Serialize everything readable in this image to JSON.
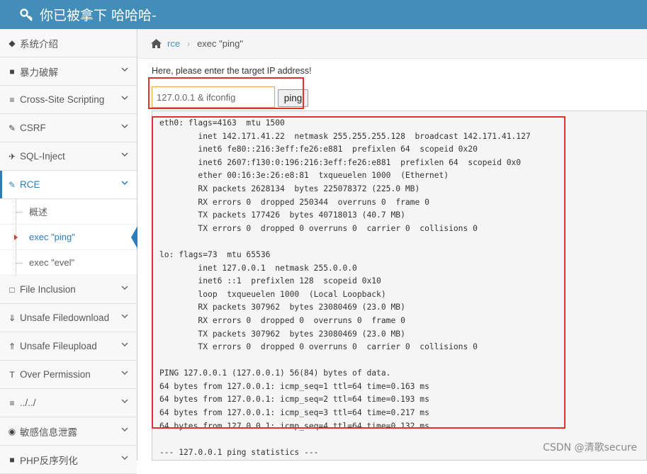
{
  "header": {
    "title": "你已被拿下 哈哈哈-",
    "logo_icon": "key-icon"
  },
  "colors": {
    "header_bg": "#438eb9",
    "accent": "#2b7dbc",
    "highlight": "#e0312f"
  },
  "sidebar": {
    "items": [
      {
        "label": "系统介绍",
        "icon": "tag-icon"
      },
      {
        "label": "暴力破解",
        "icon": "lock-icon"
      },
      {
        "label": "Cross-Site Scripting",
        "icon": "list-icon"
      },
      {
        "label": "CSRF",
        "icon": "edit-icon"
      },
      {
        "label": "SQL-Inject",
        "icon": "plane-icon"
      },
      {
        "label": "RCE",
        "icon": "pencil-icon",
        "active": true,
        "children": [
          {
            "label": "概述"
          },
          {
            "label": "exec \"ping\"",
            "active": true
          },
          {
            "label": "exec \"evel\""
          }
        ]
      },
      {
        "label": "File Inclusion",
        "icon": "file-icon"
      },
      {
        "label": "Unsafe Filedownload",
        "icon": "download-icon"
      },
      {
        "label": "Unsafe Fileupload",
        "icon": "upload-icon"
      },
      {
        "label": "Over Permission",
        "icon": "text-icon"
      },
      {
        "label": "../../",
        "icon": "align-icon"
      },
      {
        "label": "敏感信息泄露",
        "icon": "camera-icon"
      },
      {
        "label": "PHP反序列化",
        "icon": "php-icon"
      }
    ]
  },
  "breadcrumb": {
    "link": "rce",
    "current": "exec \"ping\""
  },
  "form": {
    "prompt": "Here, please enter the target IP address!",
    "ip_value": "127.0.0.1 & ifconfig",
    "button": "ping"
  },
  "output": {
    "lines": [
      "eth0: flags=4163  mtu 1500",
      "        inet 142.171.41.22  netmask 255.255.255.128  broadcast 142.171.41.127",
      "        inet6 fe80::216:3eff:fe26:e881  prefixlen 64  scopeid 0x20",
      "        inet6 2607:f130:0:196:216:3eff:fe26:e881  prefixlen 64  scopeid 0x0",
      "        ether 00:16:3e:26:e8:81  txqueuelen 1000  (Ethernet)",
      "        RX packets 2628134  bytes 225078372 (225.0 MB)",
      "        RX errors 0  dropped 250344  overruns 0  frame 0",
      "        TX packets 177426  bytes 40718013 (40.7 MB)",
      "        TX errors 0  dropped 0 overruns 0  carrier 0  collisions 0",
      "",
      "lo: flags=73  mtu 65536",
      "        inet 127.0.0.1  netmask 255.0.0.0",
      "        inet6 ::1  prefixlen 128  scopeid 0x10",
      "        loop  txqueuelen 1000  (Local Loopback)",
      "        RX packets 307962  bytes 23080469 (23.0 MB)",
      "        RX errors 0  dropped 0  overruns 0  frame 0",
      "        TX packets 307962  bytes 23080469 (23.0 MB)",
      "        TX errors 0  dropped 0 overruns 0  carrier 0  collisions 0",
      "",
      "PING 127.0.0.1 (127.0.0.1) 56(84) bytes of data.",
      "64 bytes from 127.0.0.1: icmp_seq=1 ttl=64 time=0.163 ms",
      "64 bytes from 127.0.0.1: icmp_seq=2 ttl=64 time=0.193 ms",
      "64 bytes from 127.0.0.1: icmp_seq=3 ttl=64 time=0.217 ms",
      "64 bytes from 127.0.0.1: icmp_seq=4 ttl=64 time=0.132 ms",
      "",
      "--- 127.0.0.1 ping statistics ---"
    ]
  },
  "watermark": "CSDN @清歌secure"
}
